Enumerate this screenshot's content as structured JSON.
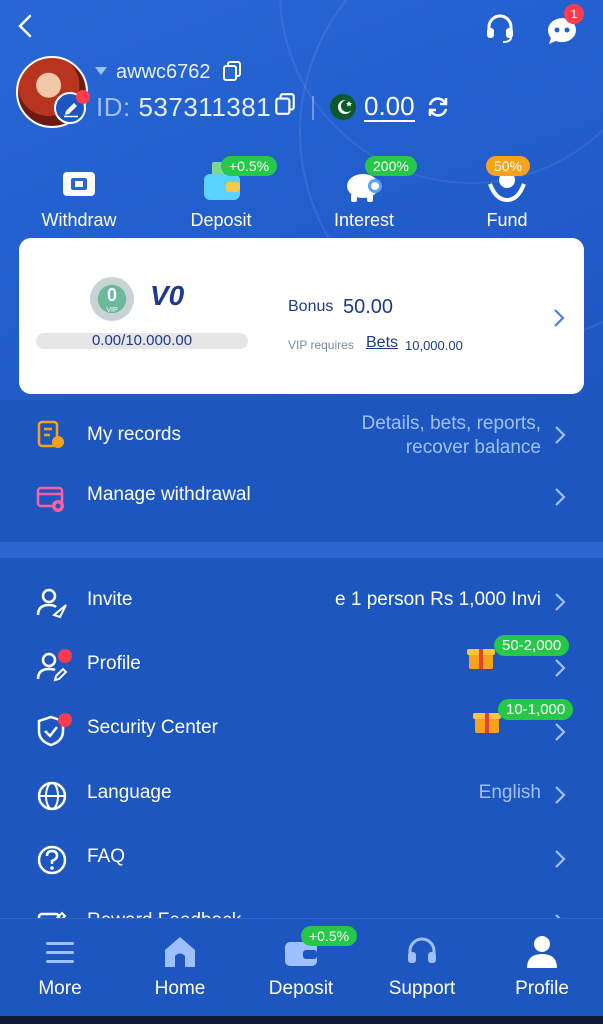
{
  "header": {
    "notifications_count": "1"
  },
  "user": {
    "username": "awwc6762",
    "id_label": "ID:",
    "id_value": "537311381",
    "balance": "0.00"
  },
  "quick_actions": [
    {
      "label": "Withdraw",
      "icon": "ticket-icon",
      "badge": ""
    },
    {
      "label": "Deposit",
      "icon": "wallet-icon",
      "badge": "+0.5%"
    },
    {
      "label": "Interest",
      "icon": "piggy-bank-icon",
      "badge": "200%"
    },
    {
      "label": "Fund",
      "icon": "hands-coin-icon",
      "badge": "50%"
    }
  ],
  "vip_card": {
    "badge_level": "0",
    "badge_sub": "VIP",
    "level": "V0",
    "progress_text": "0.00/10.000.00",
    "progress": 0,
    "bonus_label": "Bonus",
    "bonus_value": "50.00",
    "requires_label": "VIP requires",
    "bets_label": "Bets",
    "bets_value": "10,000.00"
  },
  "menu_top": [
    {
      "label": "My records",
      "value_line1": "Details, bets, reports,",
      "value_line2": "recover balance",
      "icon": "records-icon"
    },
    {
      "label": "Manage withdrawal",
      "icon": "card-settings-icon"
    }
  ],
  "menu": [
    {
      "label": "Invite",
      "value": "e 1 person Rs 1,000  Invi",
      "icon": "user-invite-icon"
    },
    {
      "label": "Profile",
      "badge": "50-2,000",
      "icon": "user-edit-icon"
    },
    {
      "label": "Security Center",
      "badge": "10-1,000",
      "icon": "shield-check-icon"
    },
    {
      "label": "Language",
      "value": "English",
      "icon": "globe-icon"
    },
    {
      "label": "FAQ",
      "icon": "question-icon"
    },
    {
      "label": "Reward Feedback",
      "icon": "edit-icon"
    }
  ],
  "tabs": [
    {
      "label": "More",
      "icon": "menu-icon"
    },
    {
      "label": "Home",
      "icon": "home-icon"
    },
    {
      "label": "Deposit",
      "icon": "wallet-icon",
      "badge": "+0.5%"
    },
    {
      "label": "Support",
      "icon": "headset-icon"
    },
    {
      "label": "Profile",
      "icon": "user-icon"
    }
  ],
  "colors": {
    "background": "#1e56c0",
    "accent_green": "#27c84a",
    "accent_orange": "#f7a21b",
    "alert_red": "#ff3b4e"
  }
}
